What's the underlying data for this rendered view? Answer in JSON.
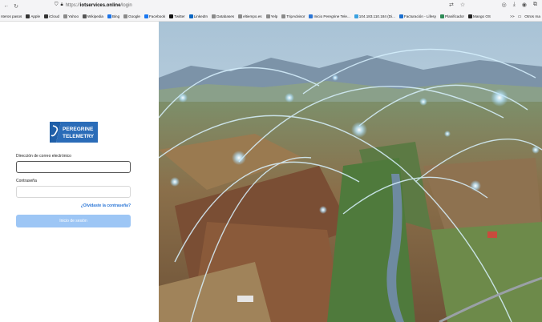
{
  "browser": {
    "url_protocol": "https://",
    "url_host": "iotservices.online",
    "url_path": "/login",
    "back_icon": "arrow-left-icon",
    "reload_icon": "reload-icon",
    "shield_icon": "shield-icon",
    "lock_icon": "lock-icon",
    "translate_icon": "translate-icon",
    "star_icon": "star-icon"
  },
  "bookmarks": {
    "items": [
      {
        "label": "nteros pasos",
        "color": "#ffffff"
      },
      {
        "label": "Apple",
        "color": "#333333"
      },
      {
        "label": "iCloud",
        "color": "#333333"
      },
      {
        "label": "Yahoo",
        "color": "#8a8a8a"
      },
      {
        "label": "Wikipedia",
        "color": "#555555"
      },
      {
        "label": "Bing",
        "color": "#1a73e8"
      },
      {
        "label": "Google",
        "color": "#8a8a8a"
      },
      {
        "label": "Facebook",
        "color": "#1877f2"
      },
      {
        "label": "Twitter",
        "color": "#111111"
      },
      {
        "label": "LinkedIn",
        "color": "#0a66c2"
      },
      {
        "label": "Databases",
        "color": "#8a8a8a"
      },
      {
        "label": "eltiempo.es",
        "color": "#8a8a8a"
      },
      {
        "label": "Yelp",
        "color": "#8a8a8a"
      },
      {
        "label": "TripAdvisor",
        "color": "#8a8a8a"
      },
      {
        "label": "Inicio Peregrine Tele...",
        "color": "#2b76d6"
      },
      {
        "label": "104.183.110.184 (Di...",
        "color": "#3aa1e0"
      },
      {
        "label": "Facturación - Lifesy",
        "color": "#1a6fd0"
      },
      {
        "label": "Planificador",
        "color": "#2e8b57"
      },
      {
        "label": "Mango OS",
        "color": "#222222"
      }
    ],
    "more_label": ">>",
    "other_label": "Otros ma"
  },
  "login": {
    "logo_line1": "PEREGRINE",
    "logo_line2": "TELEMETRY",
    "email_label": "Dirección de correo electrónico",
    "email_value": "",
    "password_label": "Contraseña",
    "password_value": "",
    "forgot_label": "¿Olvidaste la contraseña?",
    "submit_label": "Inicio de sesión"
  },
  "colors": {
    "accent": "#2b76d6",
    "button_disabled": "#9dc6f5",
    "logo_blue": "#1f5fa8"
  }
}
